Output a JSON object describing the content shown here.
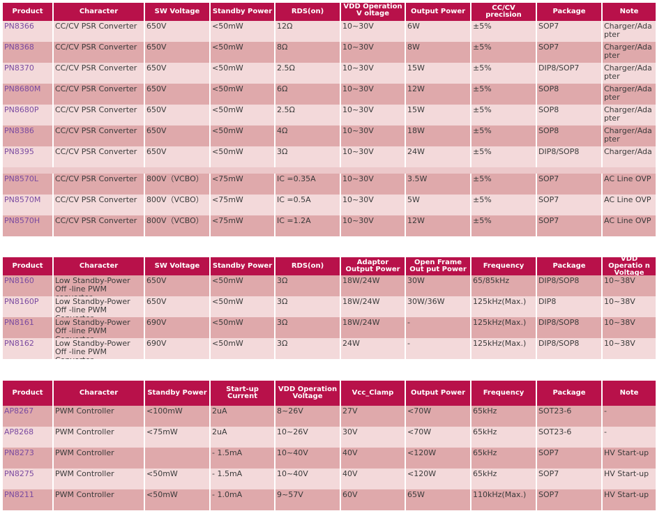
{
  "table1": {
    "headers": [
      "Product",
      "Character",
      "SW Voltage",
      "Standby Power",
      "RDS(on)",
      "VDD Operation V oltage",
      "Output Power",
      "CC/CV precision",
      "Package",
      "Note"
    ],
    "rows": [
      [
        "PN8366",
        "CC/CV PSR Converter",
        "650V",
        "<50mW",
        "12Ω",
        "10~30V",
        "6W",
        "±5%",
        "SOP7",
        "Charger/Ada pter"
      ],
      [
        "PN8368",
        "CC/CV PSR Converter",
        "650V",
        "<50mW",
        "8Ω",
        "10~30V",
        "8W",
        "±5%",
        "SOP7",
        "Charger/Ada pter"
      ],
      [
        "PN8370",
        "CC/CV PSR Converter",
        "650V",
        "<50mW",
        "2.5Ω",
        "10~30V",
        "15W",
        "±5%",
        "DIP8/SOP7",
        "Charger/Ada pter"
      ],
      [
        "PN8680M",
        "CC/CV PSR Converter",
        "650V",
        "<50mW",
        "6Ω",
        "10~30V",
        "12W",
        "±5%",
        "SOP8",
        "Charger/Ada pter"
      ],
      [
        "PN8680P",
        "CC/CV PSR Converter",
        "650V",
        "<50mW",
        "2.5Ω",
        "10~30V",
        "15W",
        "±5%",
        "SOP8",
        "Charger/Ada pter"
      ],
      [
        "PN8386",
        "CC/CV PSR Converter",
        "650V",
        "<50mW",
        "4Ω",
        "10~30V",
        "18W",
        "±5%",
        "SOP8",
        "Charger/Ada pter"
      ],
      [
        "PN8395",
        "CC/CV PSR Converter",
        "650V",
        "<50mW",
        "3Ω",
        "10~30V",
        "24W",
        "±5%",
        "DIP8/SOP8",
        "Charger/Ada"
      ]
    ],
    "rows2": [
      [
        "PN8570L",
        "CC/CV PSR Converter",
        "800V（VCBO）",
        "<75mW",
        "IC =0.35A",
        "10~30V",
        "3.5W",
        "±5%",
        "SOP7",
        "AC Line OVP"
      ],
      [
        "PN8570M",
        "CC/CV PSR Converter",
        "800V（VCBO）",
        "<75mW",
        "IC =0.5A",
        "10~30V",
        "5W",
        "±5%",
        "SOP7",
        "AC Line OVP"
      ],
      [
        "PN8570H",
        "CC/CV PSR Converter",
        "800V（VCBO）",
        "<75mW",
        "IC =1.2A",
        "10~30V",
        "12W",
        "±5%",
        "SOP7",
        "AC Line OVP"
      ]
    ]
  },
  "table2": {
    "headers": [
      "Product",
      "Character",
      "SW Voltage",
      "Standby Power",
      "RDS(on)",
      "Adaptor Output Power",
      "Open Frame Out put Power",
      "Frequency",
      "Package",
      "VDD Operatio n Voltage"
    ],
    "rows": [
      [
        "PN8160",
        "Low Standby-Power Off -line PWM converter",
        "650V",
        "<50mW",
        "3Ω",
        "18W/24W",
        "30W",
        "65/85kHz",
        "DIP8/SOP8",
        "10~38V"
      ],
      [
        "PN8160P",
        "Low Standby-Power Off -line PWM Converter",
        "650V",
        "<50mW",
        "3Ω",
        "18W/24W",
        "30W/36W",
        "125kHz(Max.)",
        "DIP8",
        "10~38V"
      ],
      [
        "PN8161",
        "Low Standby-Power Off -line PWM Converter",
        "690V",
        "<50mW",
        "3Ω",
        "18W/24W",
        "-",
        "125kHz(Max.)",
        "DIP8/SOP8",
        "10~38V"
      ],
      [
        "PN8162",
        "Low Standby-Power Off -line PWM Converter",
        "690V",
        "<50mW",
        "3Ω",
        "24W",
        "-",
        "125kHz(Max.)",
        "DIP8/SOP8",
        "10~38V"
      ]
    ]
  },
  "table3": {
    "headers": [
      "Product",
      "Character",
      "Standby Power",
      "Start-up Current",
      "VDD Operation Voltage",
      "Vcc_Clamp",
      "Output Power",
      "Frequency",
      "Package",
      "Note"
    ],
    "rows": [
      [
        "AP8267",
        "PWM Controller",
        "<100mW",
        "2uA",
        "8~26V",
        "27V",
        "<70W",
        "65kHz",
        "SOT23-6",
        "-"
      ],
      [
        "AP8268",
        "PWM Controller",
        "<75mW",
        "2uA",
        "10~26V",
        "30V",
        "<70W",
        "65kHz",
        "SOT23-6",
        "-"
      ],
      [
        "PN8273",
        "PWM Controller",
        "",
        "- 1.5mA",
        "10~40V",
        "40V",
        "<120W",
        "65kHz",
        "SOP7",
        "HV Start-up"
      ],
      [
        "PN8275",
        "PWM Controller",
        "<50mW",
        "- 1.5mA",
        "10~40V",
        "40V",
        "<120W",
        "65kHz",
        "SOP7",
        "HV Start-up"
      ],
      [
        "PN8211",
        "PWM Controller",
        "<50mW",
        "- 1.0mA",
        "9~57V",
        "60V",
        "65W",
        "110kHz(Max.)",
        "SOP7",
        "HV Start-up"
      ]
    ]
  }
}
